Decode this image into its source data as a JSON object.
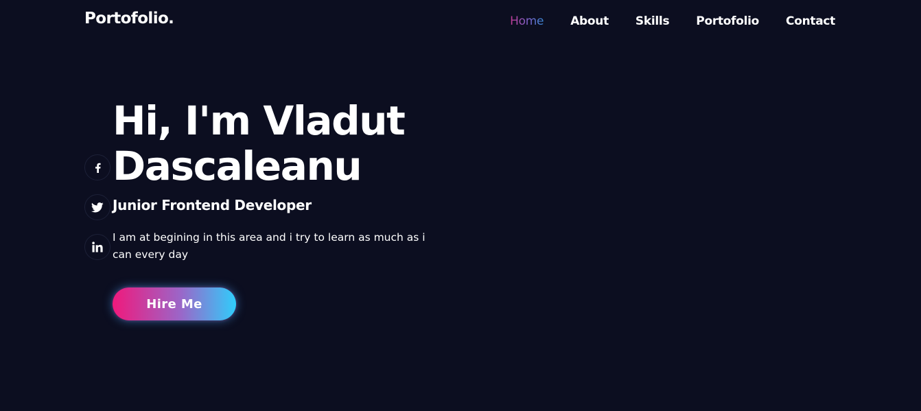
{
  "header": {
    "logo": "Portofolio.",
    "nav": [
      {
        "label": "Home",
        "active": true
      },
      {
        "label": "About",
        "active": false
      },
      {
        "label": "Skills",
        "active": false
      },
      {
        "label": "Portofolio",
        "active": false
      },
      {
        "label": "Contact",
        "active": false
      }
    ]
  },
  "social": [
    {
      "icon": "facebook-icon"
    },
    {
      "icon": "twitter-icon"
    },
    {
      "icon": "linkedin-icon"
    }
  ],
  "hero": {
    "title": "Hi, I'm Vladut Dascaleanu",
    "subtitle": "Junior Frontend Developer",
    "description": "I am at begining in this area and i try to learn as much as i can every day",
    "button_label": "Hire Me"
  },
  "colors": {
    "background": "#0c0e20",
    "accent_pink": "#f0197c",
    "accent_blue": "#30cdfb",
    "text": "#ffffff"
  }
}
